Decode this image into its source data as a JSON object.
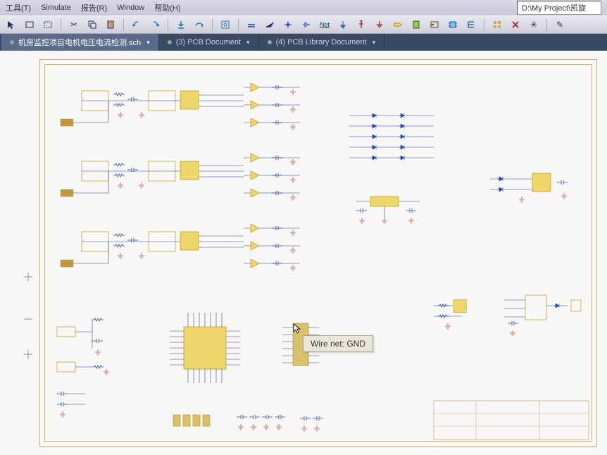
{
  "menu": {
    "tools": "工具(T)",
    "simulate": "Simulate",
    "report": "报告(R)",
    "window": "Window",
    "help": "帮助(H)",
    "path": "D:\\My Project\\凯旋"
  },
  "tabs": {
    "t1": "机房监控项目电机电压电流检测.sch",
    "t2": "(3) PCB Document",
    "t3": "(4) PCB Library Document",
    "dd": "▾"
  },
  "toolbar_icons": {
    "i1": "select",
    "i2": "box",
    "i3": "marquee",
    "i4": "cut",
    "i5": "copy",
    "i6": "paste",
    "i7": "undo",
    "i8": "redo",
    "i9": "step-in",
    "i10": "step-over",
    "i11": "zoom-fit",
    "i12": "wire",
    "i13": "bus",
    "i14": "part",
    "i15": "net",
    "i16": "port",
    "i17": "power",
    "i18": "gnd",
    "i19": "junction",
    "i20": "label",
    "i21": "sheet",
    "i22": "entry",
    "i23": "junction2",
    "i24": "array",
    "i25": "place-x",
    "i26": "snap",
    "i27": "edit"
  },
  "tooltip": {
    "text": "Wire    net: GND"
  }
}
